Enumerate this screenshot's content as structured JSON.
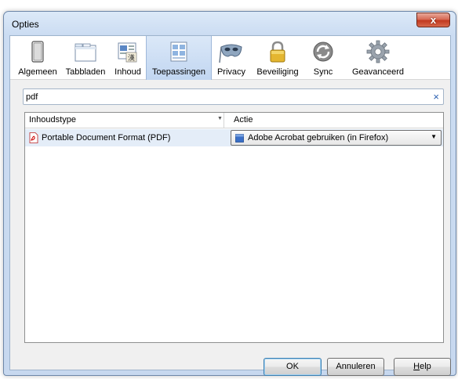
{
  "window": {
    "title": "Opties",
    "close_label": "x"
  },
  "toolbar": {
    "tabs": [
      {
        "label": "Algemeen",
        "icon": "switch-icon"
      },
      {
        "label": "Tabbladen",
        "icon": "tabs-window-icon"
      },
      {
        "label": "Inhoud",
        "icon": "content-icon"
      },
      {
        "label": "Toepassingen",
        "icon": "applications-icon",
        "selected": true
      },
      {
        "label": "Privacy",
        "icon": "mask-icon"
      },
      {
        "label": "Beveiliging",
        "icon": "padlock-icon"
      },
      {
        "label": "Sync",
        "icon": "sync-icon"
      },
      {
        "label": "Geavanceerd",
        "icon": "gear-icon"
      }
    ]
  },
  "search": {
    "value": "pdf",
    "clear_label": "×"
  },
  "table": {
    "columns": [
      "Inhoudstype",
      "Actie"
    ],
    "rows": [
      {
        "type": "Portable Document Format (PDF)",
        "action": "Adobe Acrobat gebruiken (in Firefox)"
      }
    ]
  },
  "buttons": {
    "ok": "OK",
    "cancel": "Annuleren",
    "help_first": "H",
    "help_rest": "elp"
  },
  "colors": {
    "selected_row": "#e4edf8",
    "selected_tab": "#c1d6f1",
    "close_button": "#c2391f"
  }
}
